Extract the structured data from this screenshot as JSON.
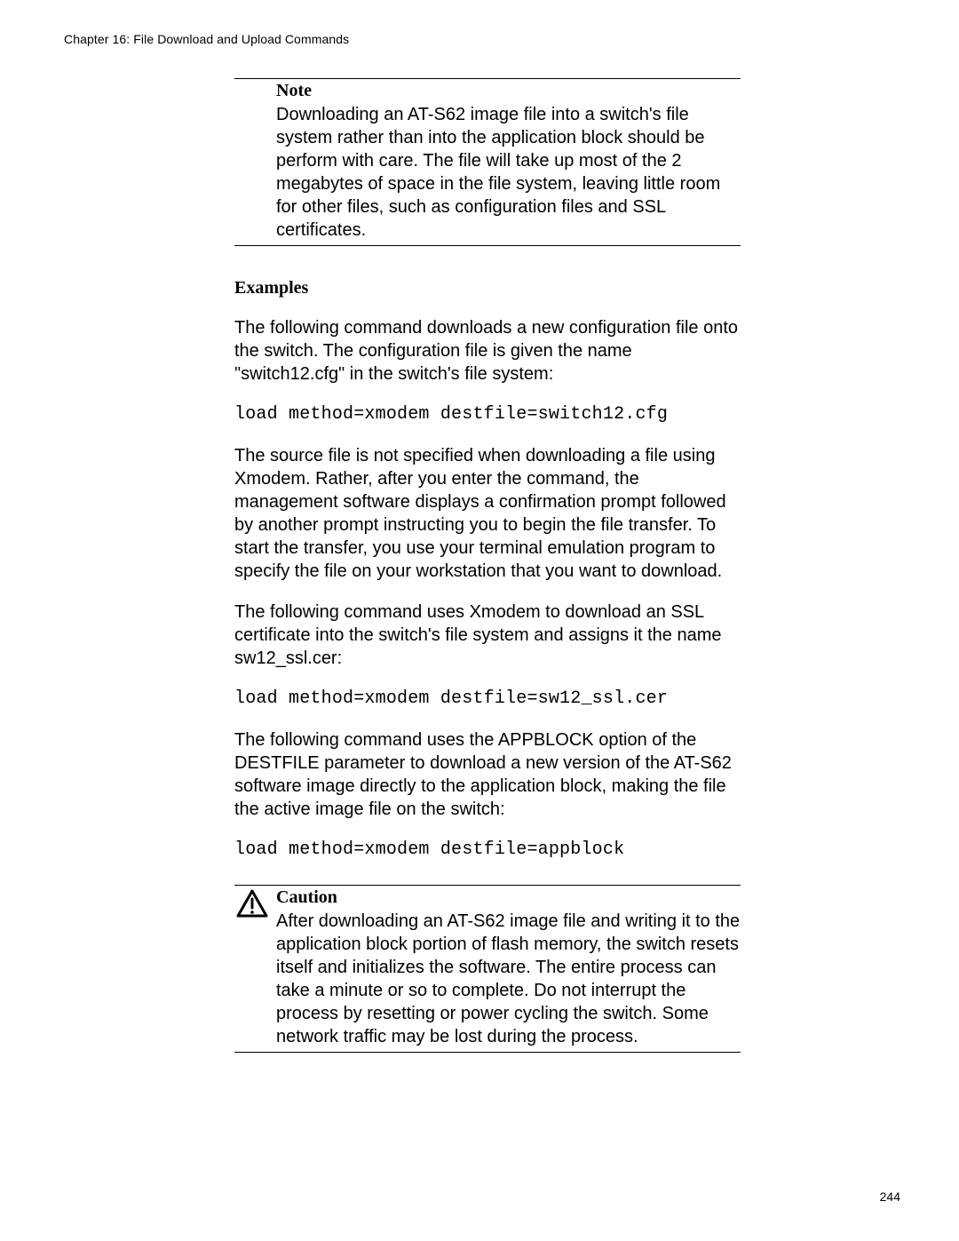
{
  "header": {
    "chapter_line": "Chapter 16: File Download and Upload Commands"
  },
  "note": {
    "title": "Note",
    "body": "Downloading an AT-S62 image file into a switch's file system rather than into the application block should be perform with care. The file will take up most of the 2 megabytes of space in the file system, leaving little room for other files, such as configuration files and SSL certificates."
  },
  "examples": {
    "heading": "Examples",
    "p1": "The following command downloads a new configuration file onto the switch. The configuration file is given the name \"switch12.cfg\" in the switch's file system:",
    "code1": "load method=xmodem destfile=switch12.cfg",
    "p2": "The source file is not specified when downloading a file using Xmodem. Rather, after you enter the command, the management software displays a confirmation prompt followed by another prompt instructing you to begin the file transfer. To start the transfer, you use your terminal emulation program to specify the file on your workstation that you want to download.",
    "p3": "The following command uses Xmodem to download an SSL certificate into the switch's file system and assigns it the name sw12_ssl.cer:",
    "code2": "load method=xmodem destfile=sw12_ssl.cer",
    "p4": "The following command uses the APPBLOCK option of the DESTFILE parameter to download a new version of the AT-S62 software image directly to the application block, making the file the active image file on the switch:",
    "code3": "load method=xmodem destfile=appblock"
  },
  "caution": {
    "title": "Caution",
    "body": "After downloading an AT-S62 image file and writing it to the application block portion of flash memory, the switch resets itself and initializes the software. The entire process can take a minute or so to complete. Do not interrupt the process by resetting or power cycling the switch. Some network traffic may be lost during the process."
  },
  "footer": {
    "page_number": "244"
  }
}
